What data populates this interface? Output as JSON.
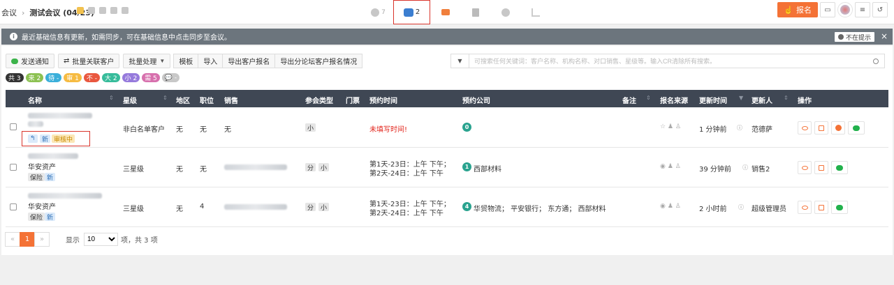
{
  "breadcrumb": {
    "root": "会议",
    "current": "测试会议 (04/23)"
  },
  "tabs": [
    {
      "icon": "person-icon",
      "count": "7"
    },
    {
      "icon": "group-icon",
      "count": "2"
    },
    {
      "icon": "ticket-icon",
      "count": ""
    },
    {
      "icon": "document-icon",
      "count": ""
    },
    {
      "icon": "camera-icon",
      "count": ""
    },
    {
      "icon": "bar-chart-icon",
      "count": ""
    }
  ],
  "header": {
    "register_label": "报名"
  },
  "notice": {
    "text": "最近基础信息有更新，如需同步，可在基础信息中点击同步至会议。",
    "dismiss": "不在提示",
    "close": "×"
  },
  "toolbar": {
    "send_notice": "发送通知",
    "bulk_link": "批量关联客户",
    "bulk_process": "批量处理",
    "template": "模板",
    "import": "导入",
    "export_signup": "导出客户报名",
    "export_forum": "导出分论坛客户报名情况",
    "search_placeholder": "可搜索任何关键词：客户名称、机构名称、对口销售、星级等。输入CR清除所有搜索。"
  },
  "filters": [
    {
      "label": "共 3",
      "color": "#333333"
    },
    {
      "label": "来 2",
      "color": "#8cc152"
    },
    {
      "label": "待 -",
      "color": "#3bafda"
    },
    {
      "label": "审 1",
      "color": "#f6bb42"
    },
    {
      "label": "不 -",
      "color": "#e9573f"
    },
    {
      "label": "大 2",
      "color": "#37bc9b"
    },
    {
      "label": "小 2",
      "color": "#967adc"
    },
    {
      "label": "需 5",
      "color": "#d770ad"
    },
    {
      "label": "💬 -",
      "color": "#c8c8c8"
    }
  ],
  "columns": {
    "name": "名称",
    "level": "星级",
    "region": "地区",
    "position": "职位",
    "sales": "销售",
    "type": "参会类型",
    "ticket": "门票",
    "time": "预约时间",
    "company": "预约公司",
    "remark": "备注",
    "source": "报名来源",
    "updated": "更新时间",
    "updater": "更新人",
    "ops": "操作"
  },
  "rows": [
    {
      "org": "",
      "tags": [
        "新",
        "审核中"
      ],
      "level": "非白名单客户",
      "region": "无",
      "position": "无",
      "sales": "无",
      "types": [
        "小"
      ],
      "time_lines": [
        "未填写时间!"
      ],
      "company_count": "0",
      "company_names": "",
      "updated": "1 分钟前",
      "updater": "范德萨"
    },
    {
      "org": "华安资产",
      "tags": [
        "保险",
        "新"
      ],
      "level": "三星级",
      "region": "无",
      "position": "无",
      "sales": "",
      "types": [
        "分",
        "小"
      ],
      "time_lines": [
        "第1天-23日：上午 下午；",
        "第2天-24日：上午 下午"
      ],
      "company_count": "1",
      "company_names": "西部材料",
      "updated": "39 分钟前",
      "updater": "销售2"
    },
    {
      "org": "华安资产",
      "tags": [
        "保险",
        "新"
      ],
      "level": "三星级",
      "region": "无",
      "position": "4",
      "sales": "",
      "types": [
        "分",
        "小"
      ],
      "time_lines": [
        "第1天-23日：上午 下午；",
        "第2天-24日：上午 下午"
      ],
      "company_count": "4",
      "company_names": "华贸物流； 平安银行； 东方通； 西部材料",
      "updated": "2 小时前",
      "updater": "超级管理员"
    }
  ],
  "pagination": {
    "prev": "«",
    "current": "1",
    "next": "»",
    "show_label": "显示",
    "page_size": "10",
    "total_text": "项，共 3 项"
  }
}
